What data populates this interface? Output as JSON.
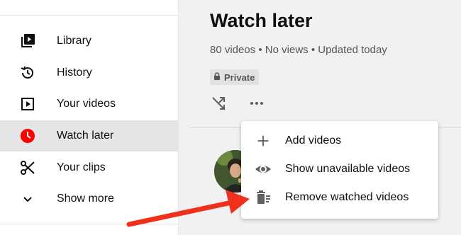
{
  "sidebar": {
    "items": [
      {
        "label": "Library",
        "icon": "library-icon"
      },
      {
        "label": "History",
        "icon": "history-icon"
      },
      {
        "label": "Your videos",
        "icon": "your-videos-icon"
      },
      {
        "label": "Watch later",
        "icon": "watch-later-icon",
        "active": true
      },
      {
        "label": "Your clips",
        "icon": "scissors-icon"
      },
      {
        "label": "Show more",
        "icon": "chevron-down-icon"
      }
    ]
  },
  "playlist": {
    "title": "Watch later",
    "meta": "80 videos • No views • Updated today",
    "privacy_label": "Private"
  },
  "menu": {
    "items": [
      {
        "label": "Add videos",
        "icon": "plus-icon"
      },
      {
        "label": "Show unavailable videos",
        "icon": "eye-icon"
      },
      {
        "label": "Remove watched videos",
        "icon": "remove-watched-icon"
      }
    ]
  },
  "colors": {
    "accent_red": "#ff0000",
    "annotation_arrow": "#f0301b",
    "sidebar_active_bg": "#e5e5e5",
    "main_bg": "#f1f1f1"
  }
}
